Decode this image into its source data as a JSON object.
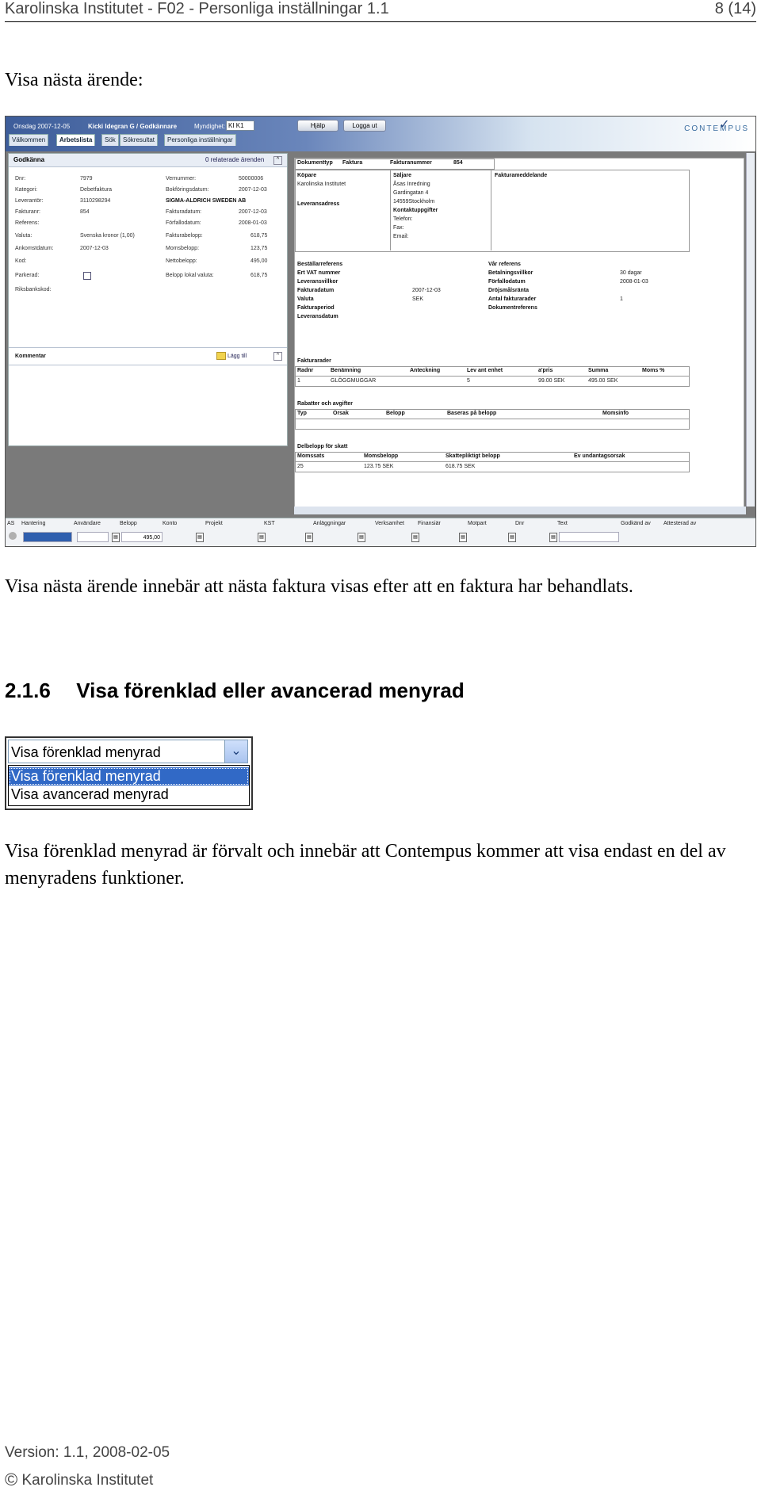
{
  "header": {
    "title": "Karolinska Institutet - F02 - Personliga inställningar 1.1",
    "page_number": "8 (14)"
  },
  "section_intro": "Visa nästa ärende:",
  "app": {
    "date": "Onsdag 2007-12-05",
    "user": "Kicki Idegran G / Godkännare",
    "authority_label": "Myndighet:",
    "authority_value": "KI K1",
    "help_button": "Hjälp",
    "logout_button": "Logga ut",
    "logo": "CONTEMPUS",
    "tabs": [
      "Välkommen",
      "Arbetslista",
      "Sök",
      "Sökresultat",
      "Personliga inställningar"
    ],
    "panel": {
      "title": "Godkänna",
      "related": "0 relaterade ärenden",
      "left_fields": [
        {
          "label": "Dnr:",
          "value": "7979"
        },
        {
          "label": "Kategori:",
          "value": "Debetfaktura"
        },
        {
          "label": "Leverantör:",
          "value": "3110298294"
        },
        {
          "label": "Fakturanr:",
          "value": "854"
        },
        {
          "label": "Referens:",
          "value": ""
        },
        {
          "label": "Valuta:",
          "value": "Svenska kronor (1,00)"
        },
        {
          "label": "Ankomstdatum:",
          "value": "2007-12-03"
        },
        {
          "label": "Kod:",
          "value": ""
        },
        {
          "label": "Parkerad:",
          "value": ""
        },
        {
          "label": "Riksbankskod:",
          "value": ""
        }
      ],
      "supplier_name": "SIGMA-ALDRICH SWEDEN AB",
      "right_fields": [
        {
          "label": "Vernummer:",
          "value": "50000006"
        },
        {
          "label": "Bokföringsdatum:",
          "value": "2007-12-03"
        },
        {
          "label": "Fakturadatum:",
          "value": "2007-12-03"
        },
        {
          "label": "Förfallodatum:",
          "value": "2008-01-03"
        },
        {
          "label": "Fakturabelopp:",
          "value": "618,75"
        },
        {
          "label": "Momsbelopp:",
          "value": "123,75"
        },
        {
          "label": "Nettobelopp:",
          "value": "495,00"
        },
        {
          "label": "Belopp lokal valuta:",
          "value": "618,75"
        }
      ],
      "comment_label": "Kommentar",
      "add_label": "Lägg till"
    },
    "invoice": {
      "doctype_label": "Dokumenttyp",
      "doctype_value": "Faktura",
      "invno_label": "Fakturanummer",
      "invno_value": "854",
      "buyer_label": "Köpare",
      "buyer_value": "Karolinska Institutet",
      "seller_label": "Säljare",
      "seller_lines": [
        "Åsas Inredning",
        "Gardingatan 4",
        "14559Stockholm"
      ],
      "contact_label": "Kontaktuppgifter",
      "contact_lines": [
        "Telefon:",
        "Fax:",
        "Email:"
      ],
      "message_label": "Fakturameddelande",
      "delivery_address_label": "Leveransadress",
      "left_refs": [
        {
          "label": "Beställarreferens",
          "value": ""
        },
        {
          "label": "Ert VAT nummer",
          "value": ""
        },
        {
          "label": "Leveransvillkor",
          "value": ""
        },
        {
          "label": "Fakturadatum",
          "value": "2007-12-03"
        },
        {
          "label": "Valuta",
          "value": "SEK"
        },
        {
          "label": "Fakturaperiod",
          "value": ""
        },
        {
          "label": "Leveransdatum",
          "value": ""
        }
      ],
      "right_refs": [
        {
          "label": "Vår referens",
          "value": ""
        },
        {
          "label": "Betalningsvillkor",
          "value": "30 dagar"
        },
        {
          "label": "Förfallodatum",
          "value": "2008-01-03"
        },
        {
          "label": "Dröjsmålsränta",
          "value": ""
        },
        {
          "label": "Antal fakturarader",
          "value": "1"
        },
        {
          "label": "Dokumentreferens",
          "value": ""
        }
      ],
      "rows_title": "Fakturarader",
      "rows_headers": [
        "Radnr",
        "Benämning",
        "Anteckning",
        "Lev ant enhet",
        "a'pris",
        "Summa",
        "Moms %"
      ],
      "rows": [
        [
          "1",
          "GLÖGGMUGGAR",
          "",
          "5",
          "99.00 SEK",
          "495.00 SEK",
          ""
        ]
      ],
      "discounts_title": "Rabatter och avgifter",
      "discounts_headers": [
        "Typ",
        "Orsak",
        "Belopp",
        "Baseras på belopp",
        "Momsinfo"
      ],
      "tax_title": "Delbelopp för skatt",
      "tax_headers": [
        "Momssats",
        "Momsbelopp",
        "Skattepliktigt belopp",
        "Ev undantagsorsak"
      ],
      "tax_rows": [
        [
          "25",
          "123.75 SEK",
          "618.75 SEK",
          ""
        ]
      ]
    },
    "bottom_headers": [
      "AS",
      "Hantering",
      "Användare",
      "Belopp",
      "Konto",
      "Projekt",
      "KST",
      "Anläggningar",
      "Verksamhet",
      "Finansiär",
      "Motpart",
      "Dnr",
      "Text",
      "Godkänd av",
      "Attesterad av"
    ],
    "bottom_amount": "495,00"
  },
  "paragraph1": "Visa nästa ärende innebär att nästa faktura visas efter att en faktura har behandlats.",
  "section_heading_number": "2.1.6",
  "section_heading_text": "Visa förenklad eller avancerad menyrad",
  "dropdown": {
    "selected": "Visa förenklad menyrad",
    "options": [
      "Visa förenklad menyrad",
      "Visa avancerad menyrad"
    ]
  },
  "paragraph2": "Visa förenklad menyrad är förvalt och innebär att Contempus kommer att visa endast en del av menyradens funktioner.",
  "footer": {
    "version": "Version: 1.1, 2008-02-05",
    "copyright_symbol": "©",
    "copyright": "Karolinska Institutet"
  }
}
